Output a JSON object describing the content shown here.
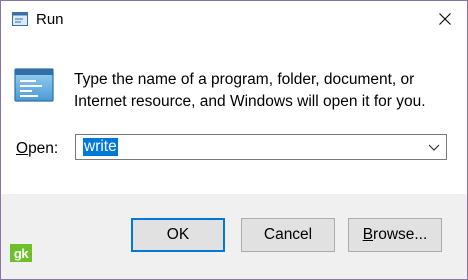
{
  "window": {
    "title": "Run",
    "icon": "run-icon",
    "close_icon": "close-icon"
  },
  "content": {
    "description": "Type the name of a program, folder, document, or Internet resource, and Windows will open it for you.",
    "open_label_prefix": "O",
    "open_label_rest": "pen:",
    "input_value": "write"
  },
  "buttons": {
    "ok_label": "OK",
    "cancel_label": "Cancel",
    "browse_label_prefix": "B",
    "browse_label_rest": "rowse..."
  },
  "watermark": {
    "text": "gk"
  },
  "colors": {
    "frame_border": "#8b73a8",
    "accent": "#0078d7",
    "footer_bg": "#f0f0f0",
    "watermark_green": "#6fbf2d"
  }
}
